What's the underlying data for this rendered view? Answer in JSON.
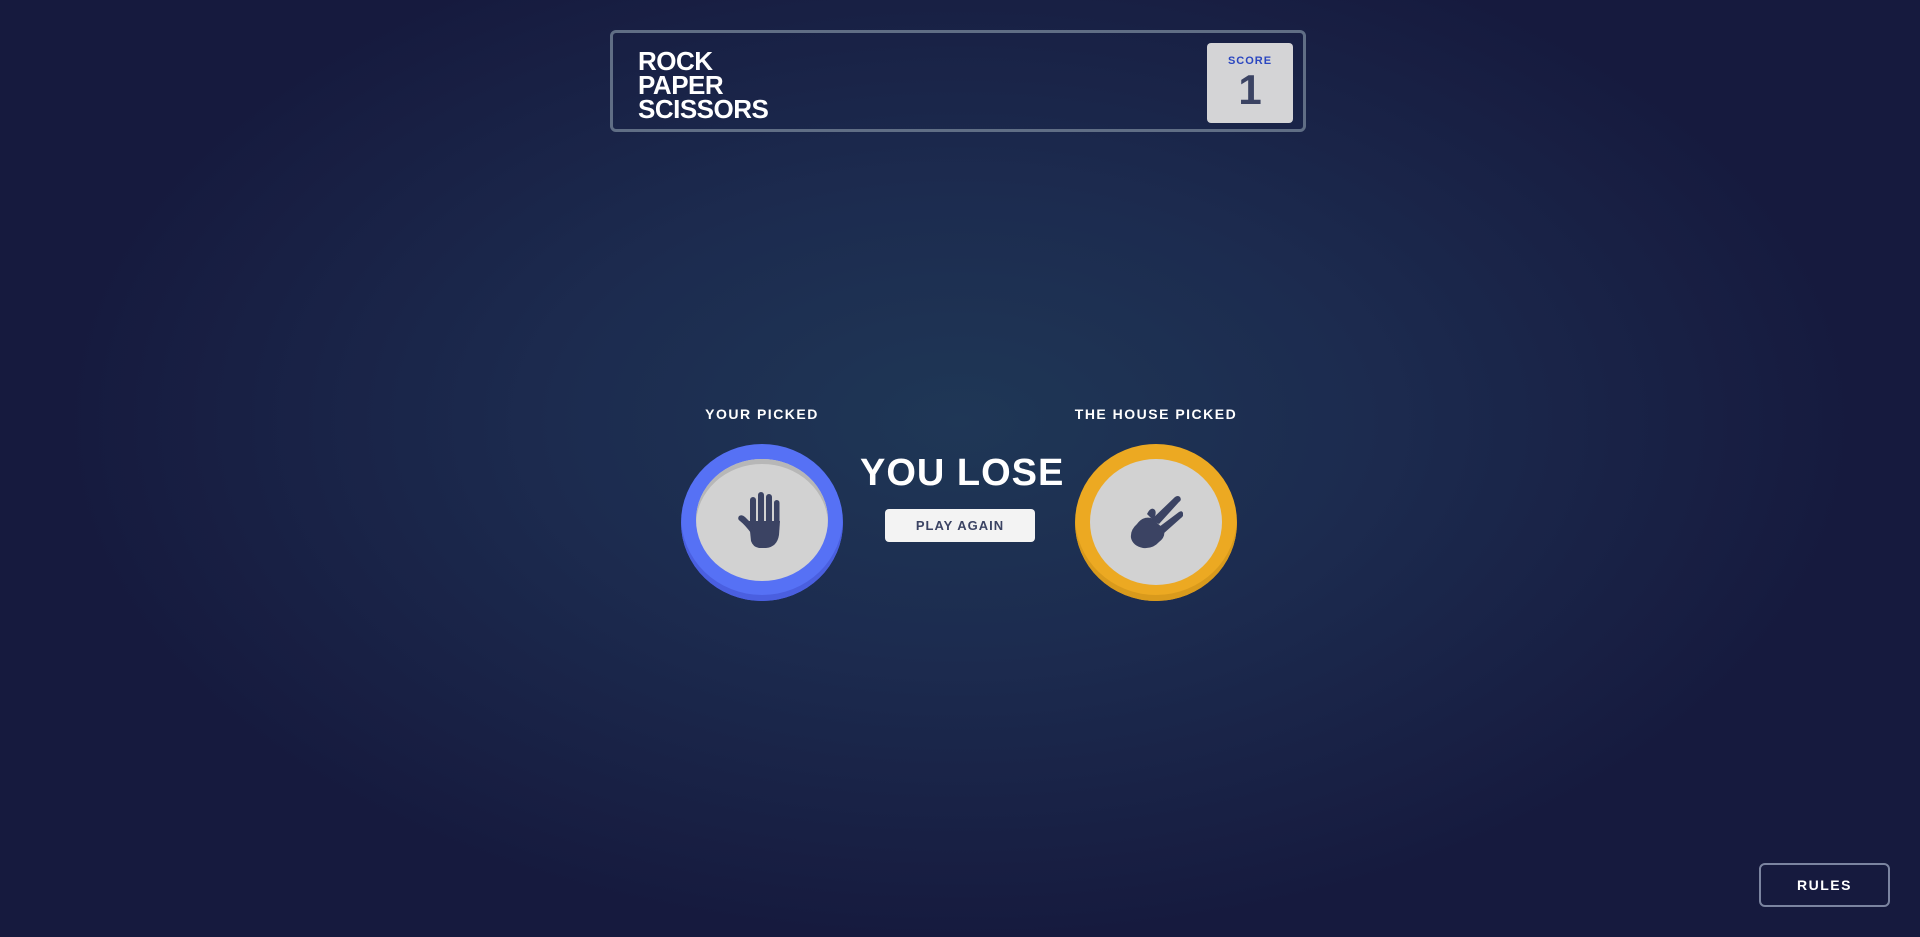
{
  "header": {
    "logo_lines": [
      "ROCK",
      "PAPER",
      "SCISSORS"
    ],
    "score_label": "SCORE",
    "score_value": "1"
  },
  "player": {
    "label": "YOUR PICKED",
    "choice": "paper",
    "icon": "paper-hand-icon",
    "ring_color": "#5671f5"
  },
  "house": {
    "label": "THE HOUSE PICKED",
    "choice": "scissors",
    "icon": "scissors-hand-icon",
    "ring_color": "#eca922"
  },
  "result": {
    "text": "YOU LOSE",
    "play_again_label": "PLAY AGAIN"
  },
  "rules": {
    "label": "RULES"
  },
  "colors": {
    "background": "#1f3756",
    "icon": "#3b4363",
    "score_label": "#2a46c0"
  }
}
